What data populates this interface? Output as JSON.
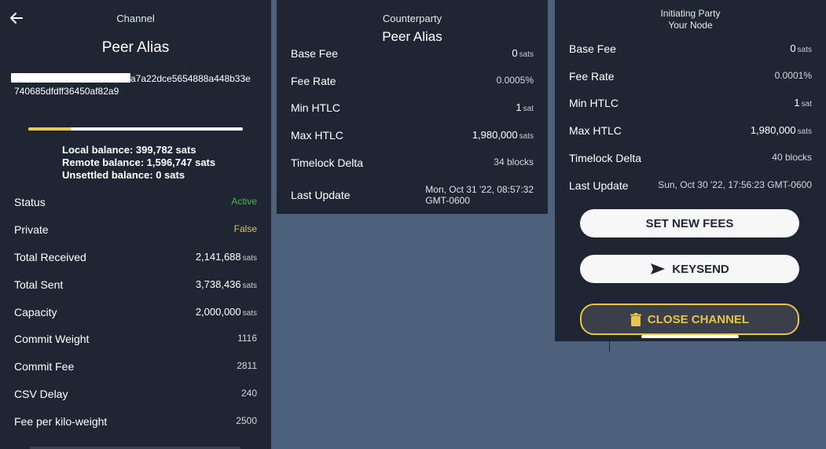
{
  "left": {
    "header": "Channel",
    "alias": "Peer Alias",
    "pubkey_line1": "a7a22dce5654888a448b33e",
    "pubkey_line2": "740685dfdff36450af82a9",
    "balance_fraction": 0.2,
    "local_balance": "Local balance: 399,782 sats",
    "remote_balance": "Remote balance: 1,596,747 sats",
    "unsettled_balance": "Unsettled balance: 0 sats",
    "rows": [
      {
        "label": "Status",
        "value": "Active"
      },
      {
        "label": "Private",
        "value": "False"
      },
      {
        "label": "Total Received",
        "value": "2,141,688",
        "unit": "sats"
      },
      {
        "label": "Total Sent",
        "value": "3,738,436",
        "unit": "sats"
      },
      {
        "label": "Capacity",
        "value": "2,000,000",
        "unit": "sats"
      },
      {
        "label": "Commit Weight",
        "value": "1116"
      },
      {
        "label": "Commit Fee",
        "value": "2811"
      },
      {
        "label": "CSV Delay",
        "value": "240"
      },
      {
        "label": "Fee per kilo-weight",
        "value": "2500"
      }
    ]
  },
  "mid": {
    "header": "Counterparty",
    "alias": "Peer Alias",
    "rows": [
      {
        "label": "Base Fee",
        "value": "0",
        "unit": "sats"
      },
      {
        "label": "Fee Rate",
        "value": "0.0005%"
      },
      {
        "label": "Min HTLC",
        "value": "1",
        "unit": "sat"
      },
      {
        "label": "Max HTLC",
        "value": "1,980,000",
        "unit": "sats"
      },
      {
        "label": "Timelock Delta",
        "value": "34 blocks"
      }
    ],
    "last_update_label": "Last Update",
    "last_update_line1": "Mon, Oct 31 '22, 08:57:32",
    "last_update_line2": "GMT-0600"
  },
  "right": {
    "header": "Initiating Party",
    "subheader": "Your Node",
    "rows": [
      {
        "label": "Base Fee",
        "value": "0",
        "unit": "sats"
      },
      {
        "label": "Fee Rate",
        "value": "0.0001%"
      },
      {
        "label": "Min HTLC",
        "value": "1",
        "unit": "sat"
      },
      {
        "label": "Max HTLC",
        "value": "1,980,000",
        "unit": "sats"
      },
      {
        "label": "Timelock Delta",
        "value": "40 blocks"
      },
      {
        "label": "Last Update",
        "value": "Sun, Oct 30 '22, 17:56:23 GMT-0600"
      }
    ],
    "set_fees_label": "SET NEW FEES",
    "keysend_label": "KEYSEND",
    "close_channel_label": "CLOSE CHANNEL"
  },
  "colors": {
    "panel": "#1f2633",
    "background": "#4d617c",
    "active": "#58b04e",
    "false": "#d9c552",
    "accent": "#e6c54a"
  },
  "icons": [
    "back-arrow-icon",
    "send-icon",
    "trash-icon"
  ]
}
